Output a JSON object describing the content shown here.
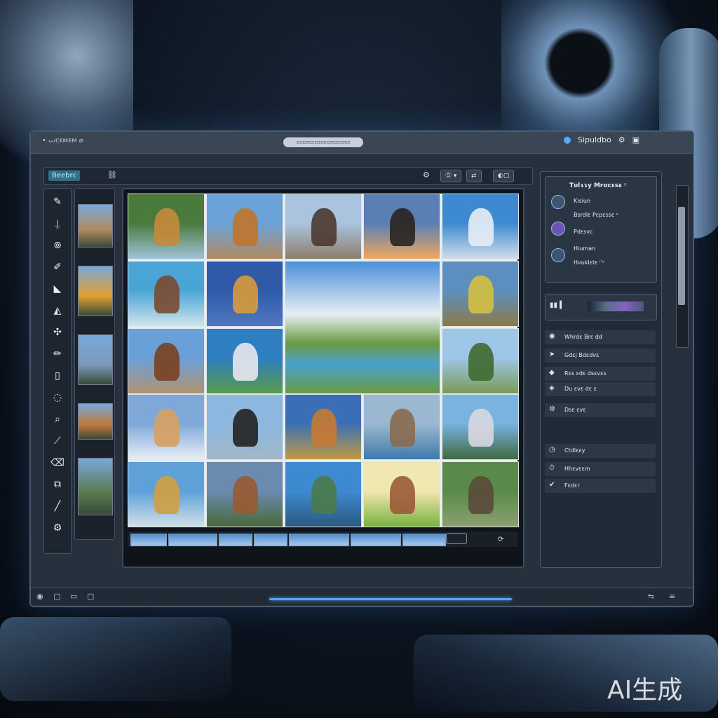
{
  "window": {
    "title_left": "• ᴗᴊᴄᴇᴍᴇᴍ ⌀",
    "title_center": "▭▭▭▭▭▭▭▭▭",
    "title_right_label": "Sipuldbo"
  },
  "toolbar": {
    "app_badge": "Beebrᴄ",
    "right_buttons": [
      "Ⓢ ▾",
      "⇄",
      "◐▢"
    ]
  },
  "left_tools": [
    {
      "icon": "pen-icon",
      "glyph": "✎"
    },
    {
      "icon": "stamp-icon",
      "glyph": "⍊"
    },
    {
      "icon": "lasso-icon",
      "glyph": "⊚"
    },
    {
      "icon": "brush-icon",
      "glyph": "✐"
    },
    {
      "icon": "fill-icon",
      "glyph": "◣"
    },
    {
      "icon": "shape-icon",
      "glyph": "◭"
    },
    {
      "icon": "move-icon",
      "glyph": "✣"
    },
    {
      "icon": "pencil-icon",
      "glyph": "✏"
    },
    {
      "icon": "layer-icon",
      "glyph": "▯"
    },
    {
      "icon": "crop-icon",
      "glyph": "◌"
    },
    {
      "icon": "dodge-icon",
      "glyph": "⌕"
    },
    {
      "icon": "smudge-icon",
      "glyph": "⟋"
    },
    {
      "icon": "eraser-icon",
      "glyph": "⌫"
    },
    {
      "icon": "clone-icon",
      "glyph": "⧉"
    },
    {
      "icon": "line-icon",
      "glyph": "╱"
    },
    {
      "icon": "settings-icon",
      "glyph": "⚙"
    }
  ],
  "grid_cells": [
    {
      "name": "lion-forest",
      "bg": "#4a7a3c",
      "bg2": "#9fc2d8",
      "fg": "#c58a3a"
    },
    {
      "name": "lion-desert",
      "bg": "#6ba3d9",
      "bg2": "#b08a60",
      "fg": "#c0762a"
    },
    {
      "name": "dog-mountains",
      "bg": "#aac4e0",
      "bg2": "#8c7d6a",
      "fg": "#4a3a30"
    },
    {
      "name": "dog-sunset",
      "bg": "#5a7fb5",
      "bg2": "#f0a860",
      "fg": "#2a2420"
    },
    {
      "name": "snow-mountain",
      "bg": "#3e8ad0",
      "bg2": "#cfdde8",
      "fg": "#e8eef5"
    },
    {
      "name": "woman-ocean",
      "bg": "#4aa5d4",
      "bg2": "#cfe4ef",
      "fg": "#7a4a30"
    },
    {
      "name": "fox-sky",
      "bg": "#2e5aa8",
      "bg2": "#5078c0",
      "fg": "#d89a3a"
    },
    {
      "name": "tree-yellow",
      "bg": "#5c8fc0",
      "bg2": "#8a7a4a",
      "fg": "#d4c040"
    },
    {
      "name": "horse-road",
      "bg": "#6aa0d8",
      "bg2": "#b09270",
      "fg": "#7a4020"
    },
    {
      "name": "castle-mountain",
      "bg": "#2e7ec0",
      "bg2": "#5a9a4a",
      "fg": "#e8e8ee"
    },
    {
      "name": "trees-field",
      "bg": "#9ec6e8",
      "bg2": "#7a9a58",
      "fg": "#3f6a30"
    },
    {
      "name": "corgi",
      "bg": "#7ea8d8",
      "bg2": "#e8eef5",
      "fg": "#d8a060"
    },
    {
      "name": "bear-dog",
      "bg": "#8cb8e0",
      "bg2": "#a0b8c8",
      "fg": "#222"
    },
    {
      "name": "fox-grass",
      "bg": "#3a6fb5",
      "bg2": "#c09a40",
      "fg": "#c87a30"
    },
    {
      "name": "city-water",
      "bg": "#9cb8d0",
      "bg2": "#3e7aa8",
      "fg": "#8a6a50"
    },
    {
      "name": "castle-lake",
      "bg": "#7ab2e0",
      "bg2": "#3e6a40",
      "fg": "#d8d8e0"
    },
    {
      "name": "bird-beach",
      "bg": "#5ea0d8",
      "bg2": "#d0e0e8",
      "fg": "#d0a040"
    },
    {
      "name": "dog-forest",
      "bg": "#6a8ab0",
      "bg2": "#4a6a3a",
      "fg": "#9a5a30"
    },
    {
      "name": "lake-mountains",
      "bg": "#3e8ad0",
      "bg2": "#2a5a80",
      "fg": "#4a7a48"
    },
    {
      "name": "boar-meadow",
      "bg": "#f0e8b0",
      "bg2": "#7ab040",
      "fg": "#9a5a38"
    },
    {
      "name": "forest-path",
      "bg": "#5a8a4a",
      "bg2": "#8aa070",
      "fg": "#5a4a3a"
    }
  ],
  "feature_cell": {
    "name": "river-landscape",
    "sky": "#4a90d8",
    "cloud": "#e8eef5",
    "land": "#6a9a40",
    "water": "#4aa0d0"
  },
  "thumbnails": [
    "#b08a60",
    "#e0a030",
    "#7a9ab8",
    "#c07838",
    "#5a7a50"
  ],
  "right_panel": {
    "header": "Tʋlɿɿy Mrocɛsɛ ᵎ",
    "items": [
      {
        "title": "Kisiun",
        "sub": "Bsrdlɛ Pɛpɛssɛ ˢ"
      },
      {
        "title": "Pdɛsvc",
        "sub": ""
      },
      {
        "title": "Hiuman",
        "sub": "Hvuklɛtɛ ⁱʼˢ"
      }
    ],
    "color_label": "▮▮ ▍",
    "rows": [
      {
        "icon": "eye-icon",
        "glyph": "◉",
        "label": "Whrdɛ Brɛ dd"
      },
      {
        "icon": "cursor-icon",
        "glyph": "➤",
        "label": "Gdɛj Bdɛdvɛ"
      },
      {
        "icon": "drop-icon",
        "glyph": "◆",
        "label": "Rɛs ɛdɛ dsɛvɛs"
      },
      {
        "icon": "camera-icon",
        "glyph": "◈",
        "label": "Du ɛvɛ dɛ ɛ"
      },
      {
        "icon": "gear-icon",
        "glyph": "⚙",
        "label": "Dsɛ ɛvɛ"
      },
      {
        "icon": "clock-icon",
        "glyph": "◷",
        "label": "Ctdlɛɛy"
      },
      {
        "icon": "timer-icon",
        "glyph": "⏱",
        "label": "Hhɛvɛɛm"
      },
      {
        "icon": "check-icon",
        "glyph": "✔",
        "label": "Fɛdɛr"
      }
    ]
  },
  "statusbar": {
    "left_icons": [
      "◉",
      "▢",
      "▭",
      "▢"
    ],
    "right_icons": [
      "⇋",
      "≡"
    ]
  },
  "watermark": "AI生成"
}
